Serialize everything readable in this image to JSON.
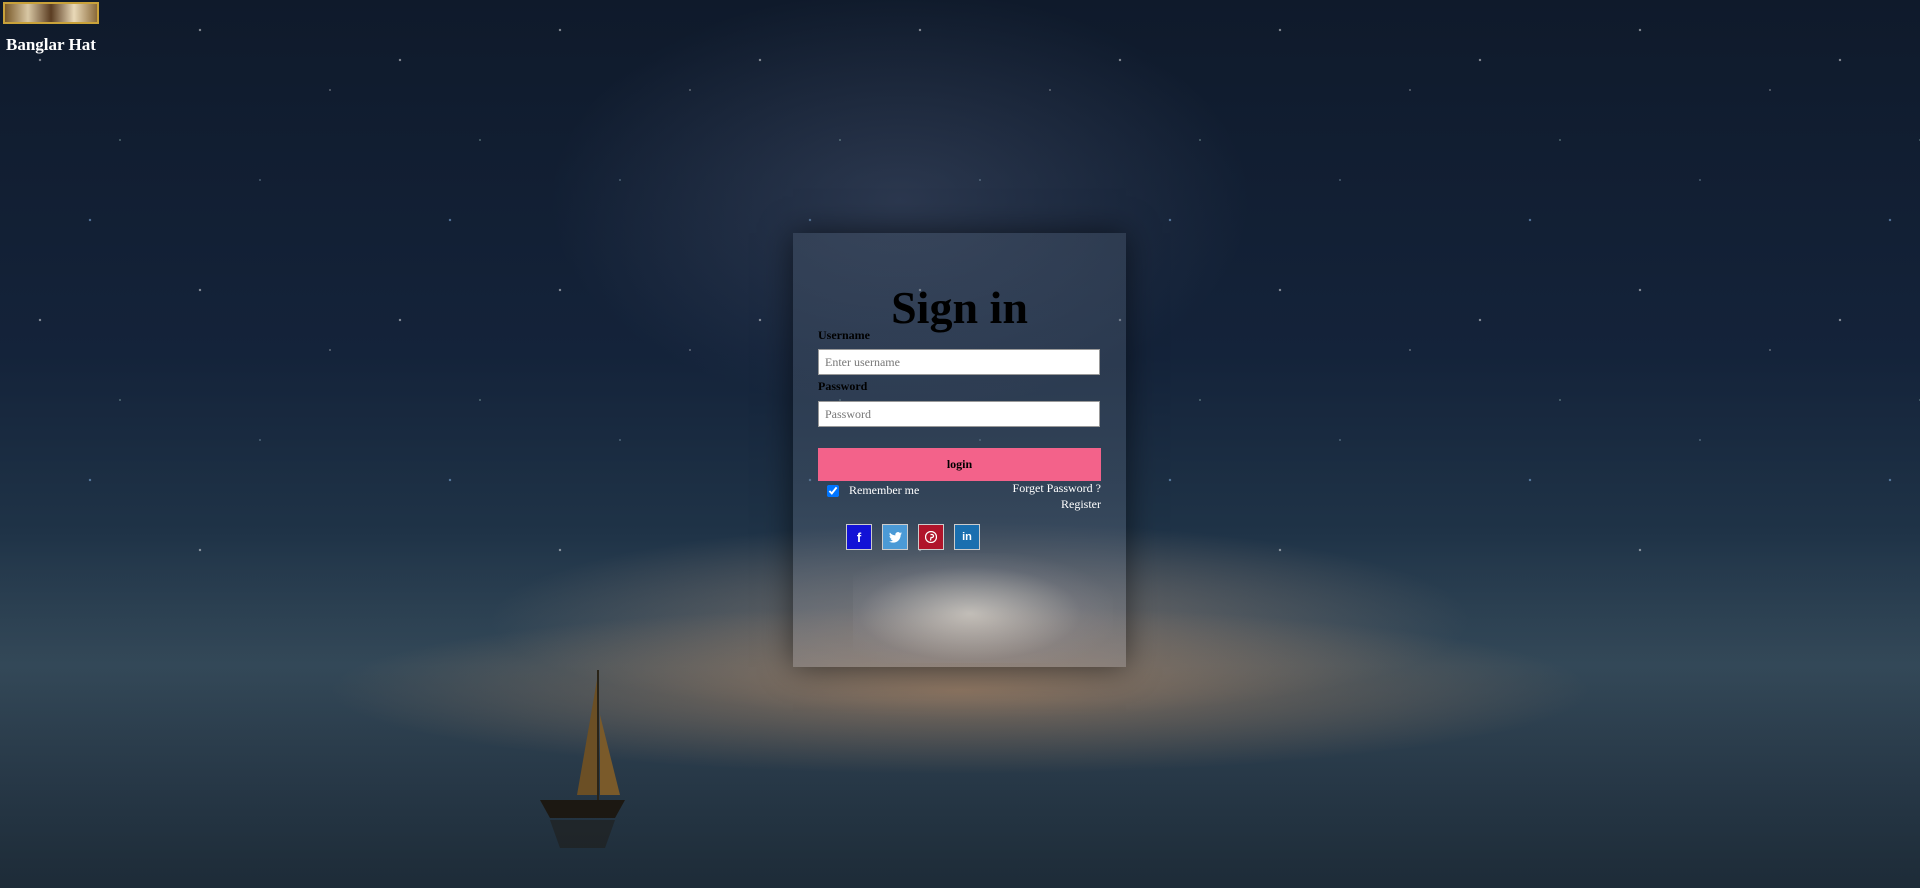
{
  "brand": {
    "name": "Banglar Hat"
  },
  "form": {
    "title": "Sign in",
    "username_label": "Username",
    "username_placeholder": "Enter username",
    "password_label": "Password",
    "password_placeholder": "Password",
    "login_label": "login",
    "remember_label": "Remember me",
    "remember_checked": true,
    "forgot_label": "Forget Password ?",
    "register_label": "Register"
  },
  "socials": [
    {
      "name": "facebook",
      "glyph": "f",
      "color": "#1212d6"
    },
    {
      "name": "twitter",
      "glyph": "t",
      "color": "#4b9ad6"
    },
    {
      "name": "pinterest",
      "glyph": "p",
      "color": "#b0142a"
    },
    {
      "name": "linkedin",
      "glyph": "in",
      "color": "#1a6faf"
    }
  ],
  "colors": {
    "login_button": "#f3628a"
  }
}
